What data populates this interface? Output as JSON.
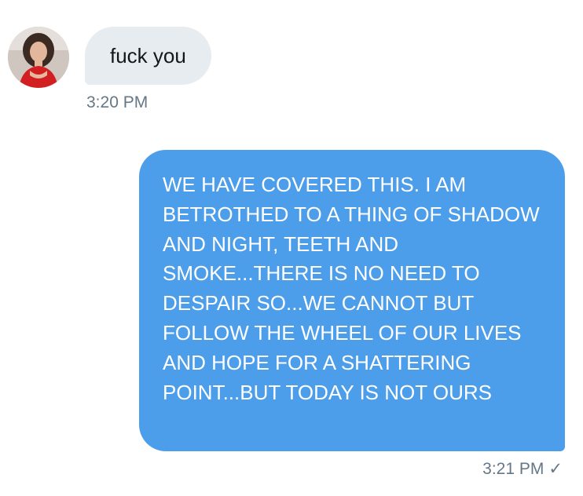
{
  "conversation": {
    "incoming": {
      "text": "fuck you",
      "time": "3:20 PM"
    },
    "outgoing": {
      "text": "WE HAVE COVERED THIS. I AM BETROTHED TO A THING OF SHADOW AND NIGHT, TEETH AND SMOKE...THERE IS NO NEED TO DESPAIR SO...WE CANNOT BUT FOLLOW THE WHEEL OF OUR LIVES AND HOPE FOR A SHATTERING POINT...BUT TODAY IS NOT OURS",
      "time": "3:21 PM",
      "status_icon": "checkmark-icon",
      "status_glyph": "✓"
    }
  },
  "colors": {
    "incoming_bubble": "#e6ecf0",
    "outgoing_bubble": "#4d9eea",
    "timestamp": "#657786"
  }
}
